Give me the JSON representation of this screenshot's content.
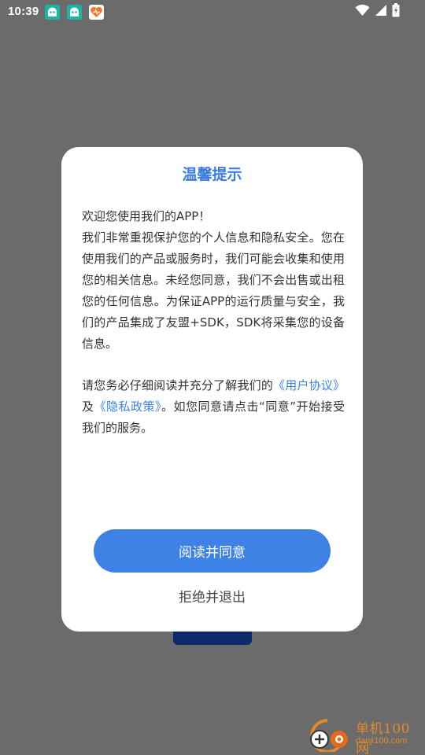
{
  "status_bar": {
    "time": "10:39",
    "left_icons": [
      "app-notification-icon",
      "app-notification-icon",
      "heart-app-icon"
    ],
    "right_icons": [
      "wifi-icon",
      "signal-icon",
      "battery-icon"
    ]
  },
  "dialog": {
    "title": "温馨提示",
    "paragraph1": "欢迎您使用我们的APP！我们非常重视保护您的个人信息和隐私安全。您在使用我们的产品或服务时，我们可能会收集和使用您的相关信息。未经您同意，我们不会出售或出租您的任何信息。为保证APP的运行质量与安全，我们的产品集成了友盟+SDK，SDK将采集您的设备信息。",
    "paragraph1_line1": "欢迎您使用我们的APP！",
    "paragraph1_rest": "我们非常重视保护您的个人信息和隐私安全。您在使用我们的产品或服务时，我们可能会收集和使用您的相关信息。未经您同意，我们不会出售或出租您的任何信息。为保证APP的运行质量与安全，我们的产品集成了友盟+SDK，SDK将采集您的设备信息。",
    "paragraph2_prefix": "请您务必仔细阅读并充分了解我们的",
    "user_agreement_link": "《用户协议》",
    "conjunction": "及",
    "privacy_policy_link": "《隐私政策》",
    "paragraph2_suffix": "。如您同意请点击“同意”开始接受我们的服务。",
    "agree_button": "阅读并同意",
    "reject_button": "拒绝并退出"
  },
  "watermark": {
    "text": "单机100网",
    "url": "danji100.com"
  },
  "colors": {
    "overlay": "#6b6b6b",
    "accent": "#3f82e6",
    "title": "#3b7be0",
    "watermark": "#e28a2a"
  }
}
